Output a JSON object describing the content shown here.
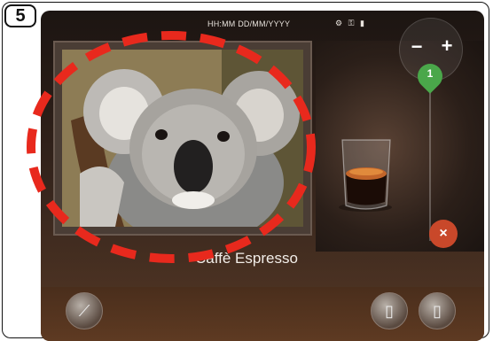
{
  "step": {
    "number": "5"
  },
  "status_bar": {
    "clock": "HH:MM DD/MM/YYYY",
    "icons": [
      "settings-icon",
      "key-icon",
      "lock-icon"
    ]
  },
  "beverage": {
    "name": "Caffè Espresso",
    "photo": "koala-photo"
  },
  "quantity": {
    "value": "1",
    "minus_label": "−",
    "plus_label": "+"
  },
  "cancel": {
    "label": "×"
  },
  "bottom_buttons": [
    "milk-wand",
    "single-cup",
    "double-cup"
  ],
  "colors": {
    "accent_green": "#4aa74a",
    "cancel_red": "#c9482a",
    "highlight_red": "#e8291d"
  }
}
